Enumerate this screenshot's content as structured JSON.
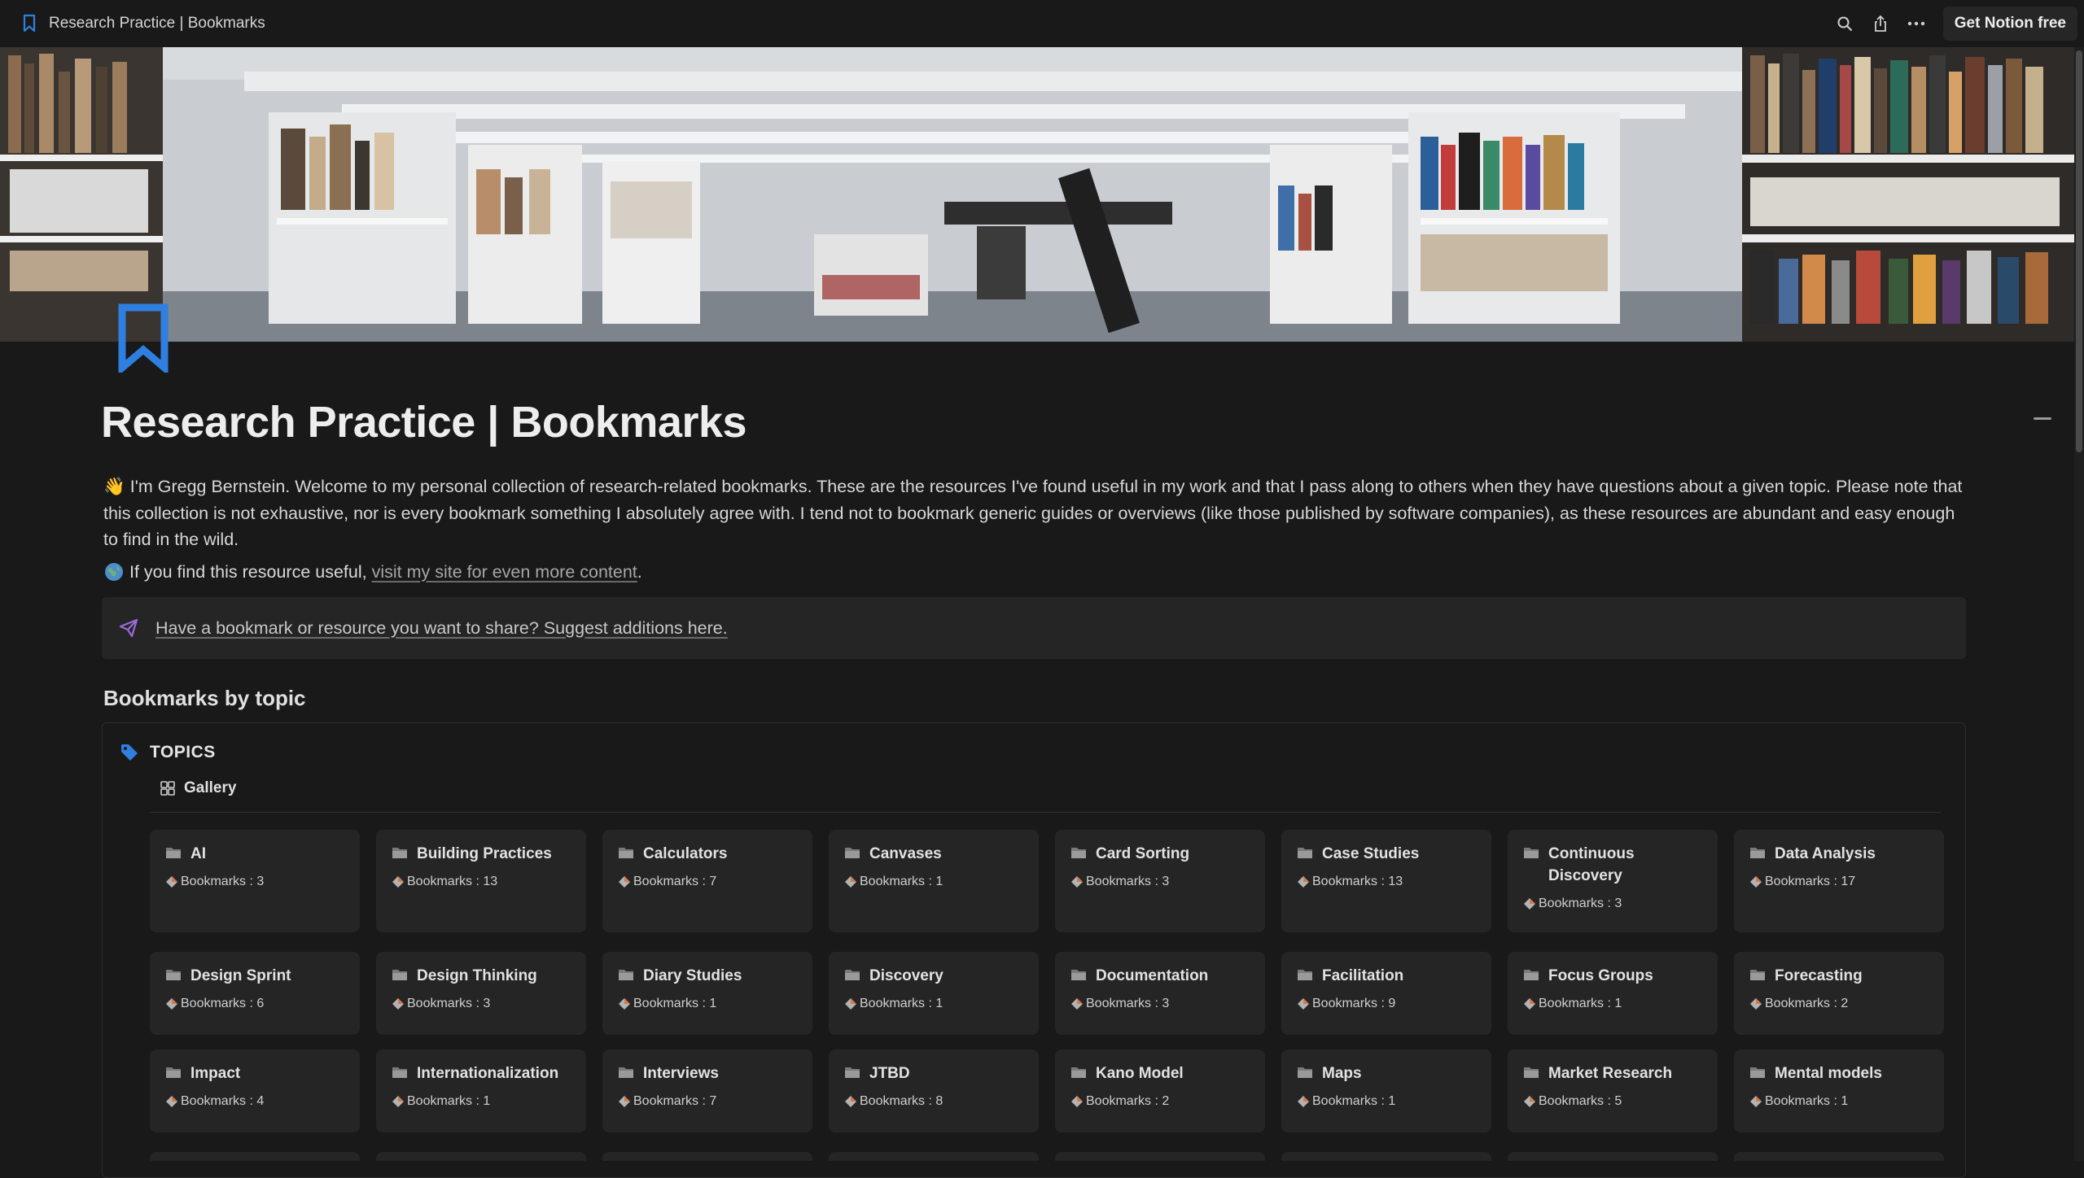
{
  "topbar": {
    "title": "Research Practice | Bookmarks",
    "get_notion_label": "Get Notion free",
    "icons": [
      "bookmark-icon",
      "search-icon",
      "share-icon",
      "more-icon"
    ]
  },
  "page": {
    "title": "Research Practice | Bookmarks",
    "intro_emoji": "👋",
    "intro": "I'm Gregg Bernstein. Welcome to my personal collection of research-related bookmarks. These are the resources I've found useful in my work and that I pass along to others when they have questions about a given topic. Please note that this collection is not exhaustive, nor is every bookmark something I absolutely agree with. I tend not to bookmark generic guides or overviews (like those published by software companies), as these resources are abundant and easy enough to find in the wild.",
    "intro2_prefix": "If you find this resource useful, ",
    "intro2_link": "visit my site for even more content",
    "intro2_suffix": ".",
    "callout": "Have a bookmark or resource you want to share? Suggest additions here.",
    "section_heading": "Bookmarks by topic"
  },
  "database": {
    "name": "TOPICS",
    "view_label": "Gallery",
    "cards": [
      {
        "title": "AI",
        "prop": "Bookmarks : 3"
      },
      {
        "title": "Building Practices",
        "prop": "Bookmarks : 13"
      },
      {
        "title": "Calculators",
        "prop": "Bookmarks : 7"
      },
      {
        "title": "Canvases",
        "prop": "Bookmarks : 1"
      },
      {
        "title": "Card Sorting",
        "prop": "Bookmarks : 3"
      },
      {
        "title": "Case Studies",
        "prop": "Bookmarks : 13"
      },
      {
        "title": "Continuous Discovery",
        "prop": "Bookmarks : 3"
      },
      {
        "title": "Data Analysis",
        "prop": "Bookmarks : 17"
      },
      {
        "title": "Design Sprint",
        "prop": "Bookmarks : 6"
      },
      {
        "title": "Design Thinking",
        "prop": "Bookmarks : 3"
      },
      {
        "title": "Diary Studies",
        "prop": "Bookmarks : 1"
      },
      {
        "title": "Discovery",
        "prop": "Bookmarks : 1"
      },
      {
        "title": "Documentation",
        "prop": "Bookmarks : 3"
      },
      {
        "title": "Facilitation",
        "prop": "Bookmarks : 9"
      },
      {
        "title": "Focus Groups",
        "prop": "Bookmarks : 1"
      },
      {
        "title": "Forecasting",
        "prop": "Bookmarks : 2"
      },
      {
        "title": "Impact",
        "prop": "Bookmarks : 4"
      },
      {
        "title": "Internationalization",
        "prop": "Bookmarks : 1"
      },
      {
        "title": "Interviews",
        "prop": "Bookmarks : 7"
      },
      {
        "title": "JTBD",
        "prop": "Bookmarks : 8"
      },
      {
        "title": "Kano Model",
        "prop": "Bookmarks : 2"
      },
      {
        "title": "Maps",
        "prop": "Bookmarks : 1"
      },
      {
        "title": "Market Research",
        "prop": "Bookmarks : 5"
      },
      {
        "title": "Mental models",
        "prop": "Bookmarks : 1"
      }
    ]
  },
  "colors": {
    "background": "#191919",
    "card": "#252525",
    "accent_blue": "#2f7fe0",
    "callout_icon": "#9b6bd8"
  }
}
